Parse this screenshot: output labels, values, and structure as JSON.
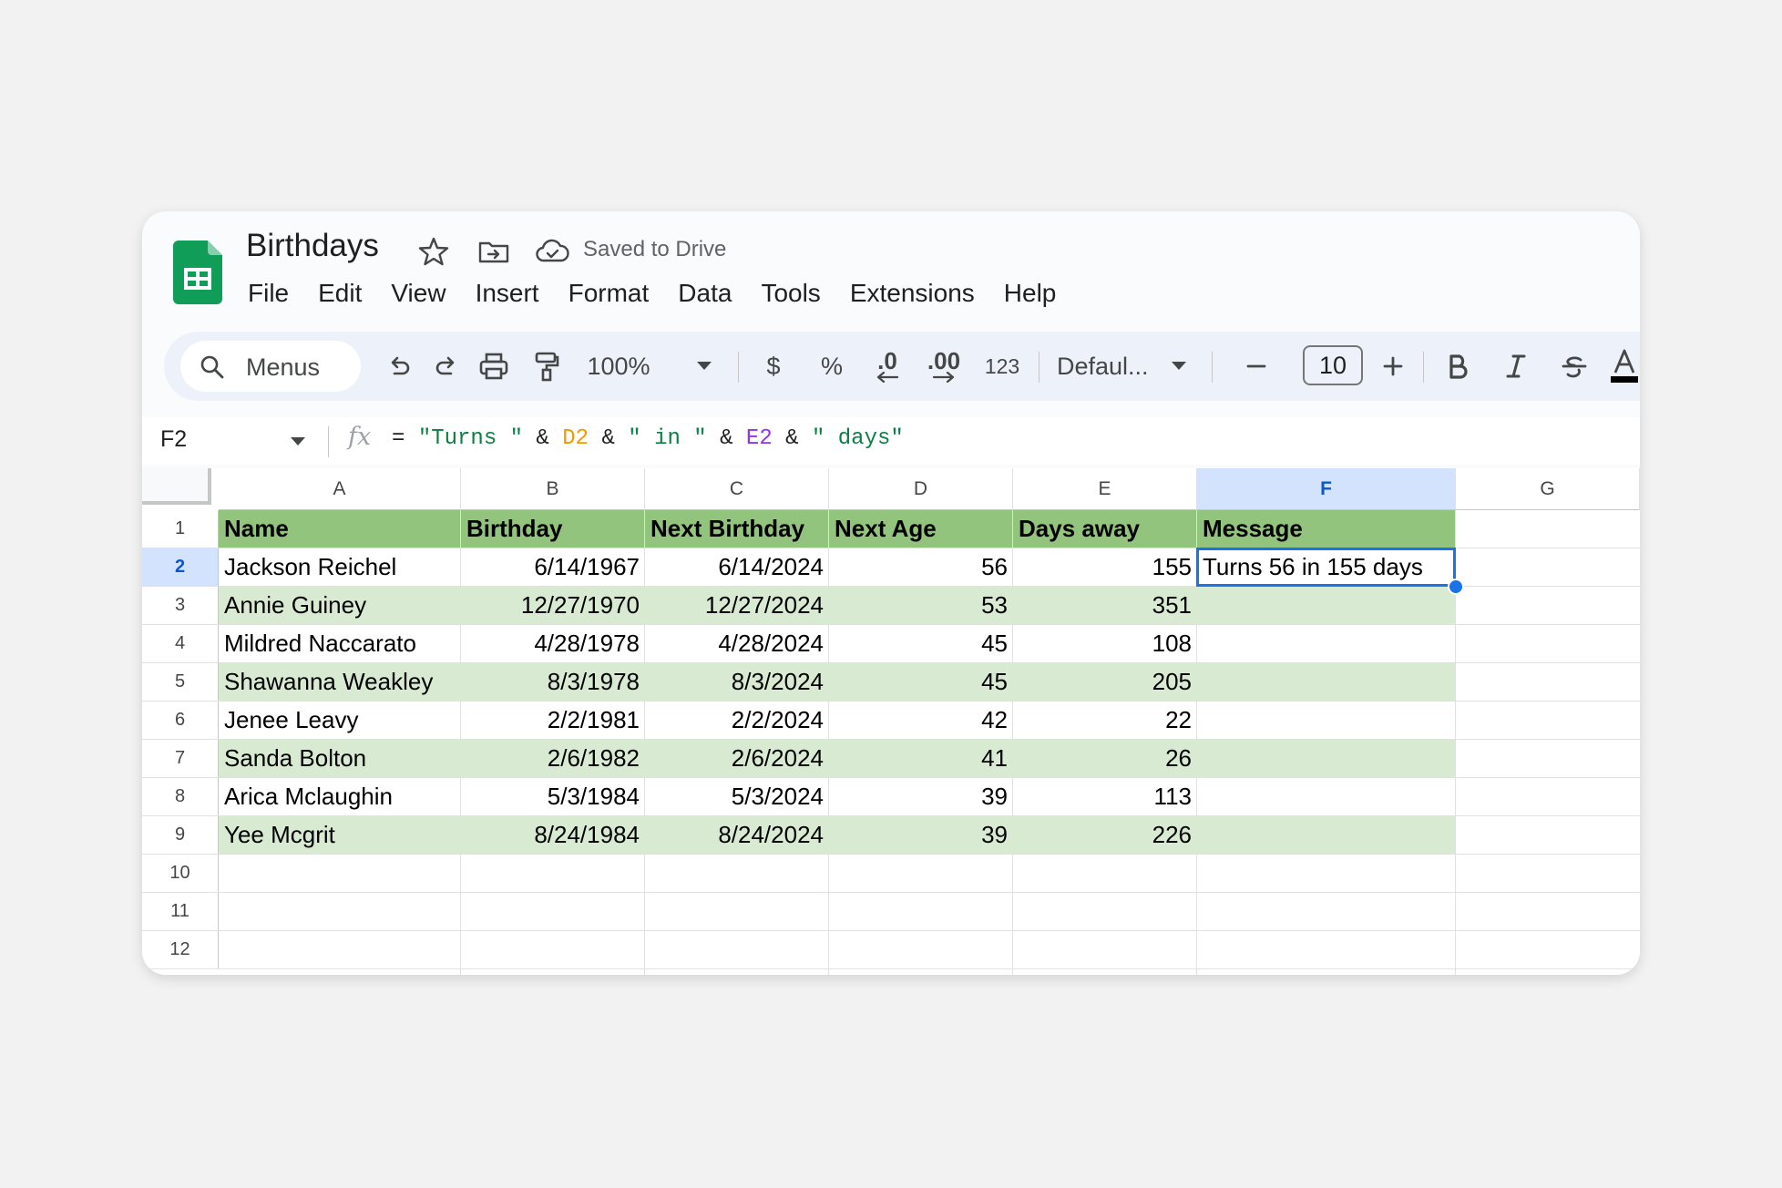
{
  "app": {
    "doc_title": "Birthdays",
    "save_status": "Saved to Drive",
    "menus": [
      "File",
      "Edit",
      "View",
      "Insert",
      "Format",
      "Data",
      "Tools",
      "Extensions",
      "Help"
    ]
  },
  "toolbar": {
    "search_label": "Menus",
    "zoom": "100%",
    "currency": "$",
    "percent": "%",
    "decrease_decimal": ".0",
    "increase_decimal": ".00",
    "number_format": "123",
    "font": "Defaul...",
    "font_size": "10",
    "icons": [
      "search-icon",
      "undo-icon",
      "redo-icon",
      "print-icon",
      "paint-format-icon",
      "minus-icon",
      "plus-icon",
      "bold-icon",
      "italic-icon",
      "strikethrough-icon",
      "text-color-icon"
    ]
  },
  "formula_bar": {
    "cell_ref": "F2",
    "fx": "fx",
    "formula_parts": [
      "= ",
      "\"Turns \"",
      " & ",
      "D2",
      " & ",
      "\" in \"",
      " & ",
      "E2",
      " & ",
      "\" days\""
    ]
  },
  "sheet": {
    "column_letters": [
      "A",
      "B",
      "C",
      "D",
      "E",
      "F",
      "G"
    ],
    "selected_column": "F",
    "row_numbers": [
      "1",
      "2",
      "3",
      "4",
      "5",
      "6",
      "7",
      "8",
      "9",
      "10",
      "11",
      "12"
    ],
    "selected_row": "2",
    "header": [
      "Name",
      "Birthday",
      "Next Birthday",
      "Next Age",
      "Days away",
      "Message"
    ],
    "rows": [
      [
        "Jackson Reichel",
        "6/14/1967",
        "6/14/2024",
        "56",
        "155",
        "Turns 56 in 155 days"
      ],
      [
        "Annie Guiney",
        "12/27/1970",
        "12/27/2024",
        "53",
        "351",
        ""
      ],
      [
        "Mildred Naccarato",
        "4/28/1978",
        "4/28/2024",
        "45",
        "108",
        ""
      ],
      [
        "Shawanna Weakley",
        "8/3/1978",
        "8/3/2024",
        "45",
        "205",
        ""
      ],
      [
        "Jenee Leavy",
        "2/2/1981",
        "2/2/2024",
        "42",
        "22",
        ""
      ],
      [
        "Sanda Bolton",
        "2/6/1982",
        "2/6/2024",
        "41",
        "26",
        ""
      ],
      [
        "Arica Mclaughin",
        "5/3/1984",
        "5/3/2024",
        "39",
        "113",
        ""
      ],
      [
        "Yee Mcgrit",
        "8/24/1984",
        "8/24/2024",
        "39",
        "226",
        ""
      ]
    ],
    "colors": {
      "header_fill": "#93c47d",
      "band_fill": "#d9ead3",
      "selection": "#1a73e8"
    }
  }
}
